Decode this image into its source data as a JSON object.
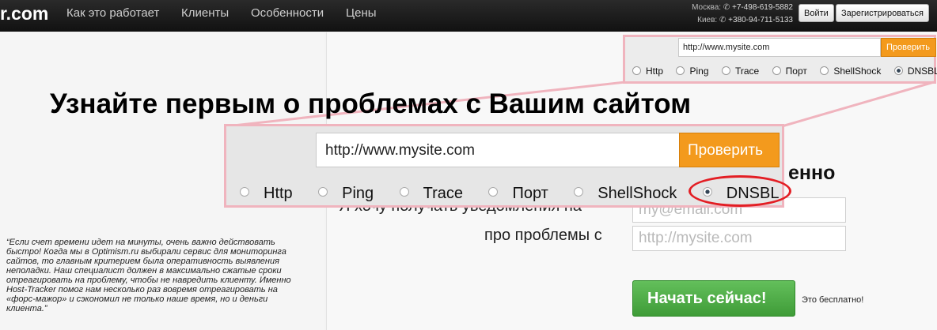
{
  "navbar": {
    "logo": "r.com",
    "items": [
      "Как это работает",
      "Клиенты",
      "Особенности",
      "Цены"
    ],
    "contacts": {
      "moscow_label": "Москва:",
      "moscow_phone": "+7-498-619-5882",
      "kiev_label": "Киев:",
      "kiev_phone": "+380-94-711-5133"
    },
    "login_label": "Войти",
    "register_label": "Зарегистрироваться"
  },
  "check_widget": {
    "url_value": "http://www.mysite.com",
    "check_label": "Проверить",
    "options": [
      "Http",
      "Ping",
      "Trace",
      "Порт",
      "ShellShock",
      "DNSBL"
    ],
    "selected_option": "DNSBL"
  },
  "hero": {
    "headline": "Узнайте первым о проблемах с Вашим сайтом",
    "subhead_tail": "енно"
  },
  "signup": {
    "notify_label": "Я хочу получать уведомления на",
    "problems_label": "про проблемы с",
    "email_placeholder": "my@email.com",
    "site_placeholder": "http://mysite.com",
    "start_label": "Начать сейчас!",
    "free_note": "Это бесплатно!"
  },
  "testimonial": {
    "text": "“Если счет времени идет на минуты, очень важно действовать быстро! Когда мы в Optimism.ru выбирали сервис для мониторинга сайтов, то главным критерием была оперативность выявления неполадки. Наш специалист должен в максимально сжатые сроки отреагировать на проблему, чтобы не навредить клиенту. Именно Host-Tracker помог нам несколько раз вовремя отреагировать на «форс-мажор» и сэкономил не только наше время, но и деньги клиента.”"
  },
  "colors": {
    "accent_orange": "#f39a1d",
    "start_green": "#4cae44",
    "zoom_border": "#f0b4be",
    "highlight_red": "#e31e24"
  }
}
